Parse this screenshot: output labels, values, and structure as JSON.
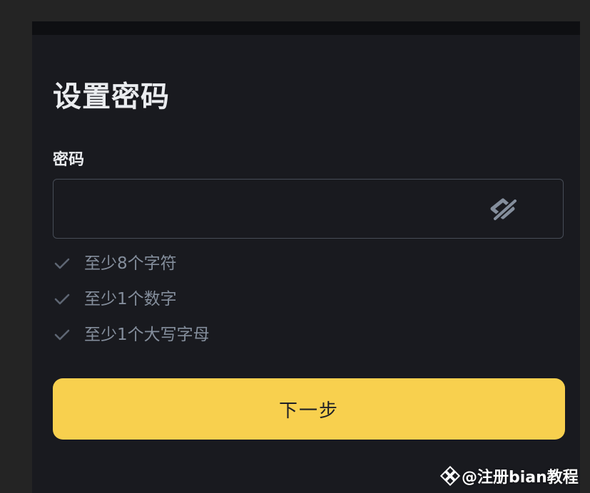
{
  "page": {
    "title": "设置密码"
  },
  "password_field": {
    "label": "密码",
    "value": "",
    "toggle_icon": "eye-slash-icon"
  },
  "rules": [
    {
      "icon": "check-icon",
      "text": "至少8个字符"
    },
    {
      "icon": "check-icon",
      "text": "至少1个数字"
    },
    {
      "icon": "check-icon",
      "text": "至少1个大写字母"
    }
  ],
  "actions": {
    "next_label": "下一步"
  },
  "watermark": {
    "text": "@注册bian教程"
  },
  "colors": {
    "background": "#191a1f",
    "outer_background": "#242424",
    "accent": "#f8d04e",
    "primary_text": "#eaecef",
    "secondary_text": "#848e9c",
    "border": "#474d57"
  }
}
